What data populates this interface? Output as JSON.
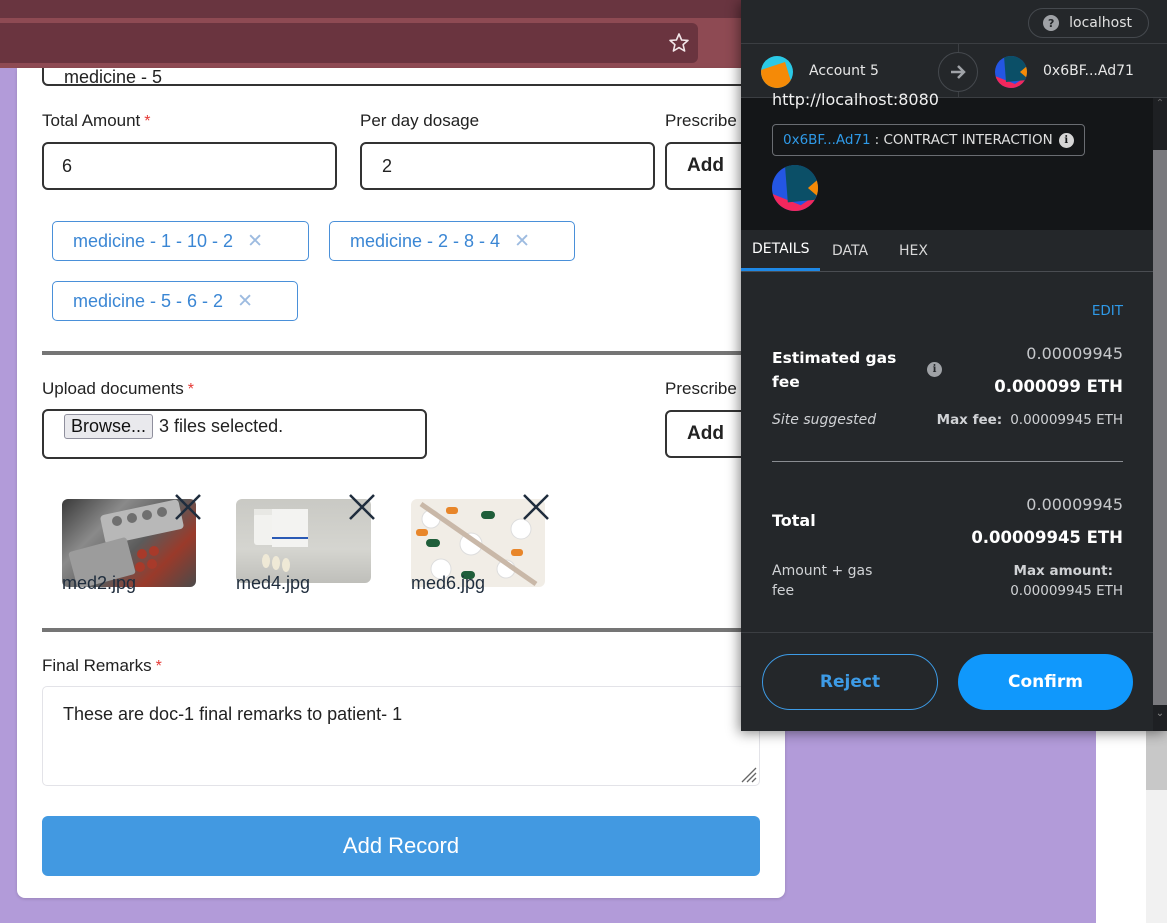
{
  "browser": {
    "bookmark_icon": "star-icon"
  },
  "form": {
    "medicine_name_partial": "medicine - 5",
    "total_amount": {
      "label": "Total Amount",
      "required": "*",
      "value": "6"
    },
    "per_day_dosage": {
      "label": "Per day dosage",
      "value": "2"
    },
    "prescribe_label": "Prescribe",
    "add_label": "Add",
    "medicine_chips": [
      {
        "text": "medicine - 1 -  10 -  2",
        "remove": "✕"
      },
      {
        "text": "medicine - 2 -  8 -  4",
        "remove": "✕"
      },
      {
        "text": "medicine - 5 -  6 -  2",
        "remove": "✕"
      }
    ],
    "upload": {
      "label": "Upload documents",
      "required": "*",
      "browse_label": "Browse...",
      "status": "3 files selected."
    },
    "prescribe_label_2": "Prescribe",
    "add_label_2": "Add",
    "files": [
      {
        "name": "med2.jpg",
        "remove_icon": "close-icon"
      },
      {
        "name": "med4.jpg",
        "remove_icon": "close-icon"
      },
      {
        "name": "med6.jpg",
        "remove_icon": "close-icon"
      }
    ],
    "final_remarks": {
      "label": "Final Remarks",
      "required": "*",
      "value": "These are doc-1 final remarks to patient- 1"
    },
    "submit_label": "Add Record"
  },
  "metamask": {
    "site": {
      "icon": "?",
      "label": "localhost"
    },
    "from_account": "Account 5",
    "to_account": "0x6BF...Ad71",
    "origin": "http://localhost:8080",
    "contract": {
      "address": "0x6BF...Ad71",
      "label": ": CONTRACT INTERACTION",
      "info_icon": "i"
    },
    "tabs": [
      {
        "label": "DETAILS",
        "active": true
      },
      {
        "label": "DATA",
        "active": false
      },
      {
        "label": "HEX",
        "active": false
      }
    ],
    "edit_label": "EDIT",
    "gas": {
      "label_line1": "Estimated gas",
      "label_line2": "fee",
      "info_icon": "i",
      "secondary": "0.00009945",
      "primary": "0.000099 ETH",
      "suggested": "Site suggested",
      "max_fee_label": "Max fee:",
      "max_fee_value": "0.00009945 ETH"
    },
    "total": {
      "label": "Total",
      "secondary": "0.00009945",
      "primary": "0.00009945 ETH",
      "sub_line1": "Amount + gas",
      "sub_line2": "fee",
      "max_amount_label": "Max amount:",
      "max_amount_value": "0.00009945 ETH"
    },
    "reject_label": "Reject",
    "confirm_label": "Confirm",
    "colors": {
      "accent": "#1098fc",
      "link": "#2f9ae8",
      "panel": "#24272a"
    }
  }
}
